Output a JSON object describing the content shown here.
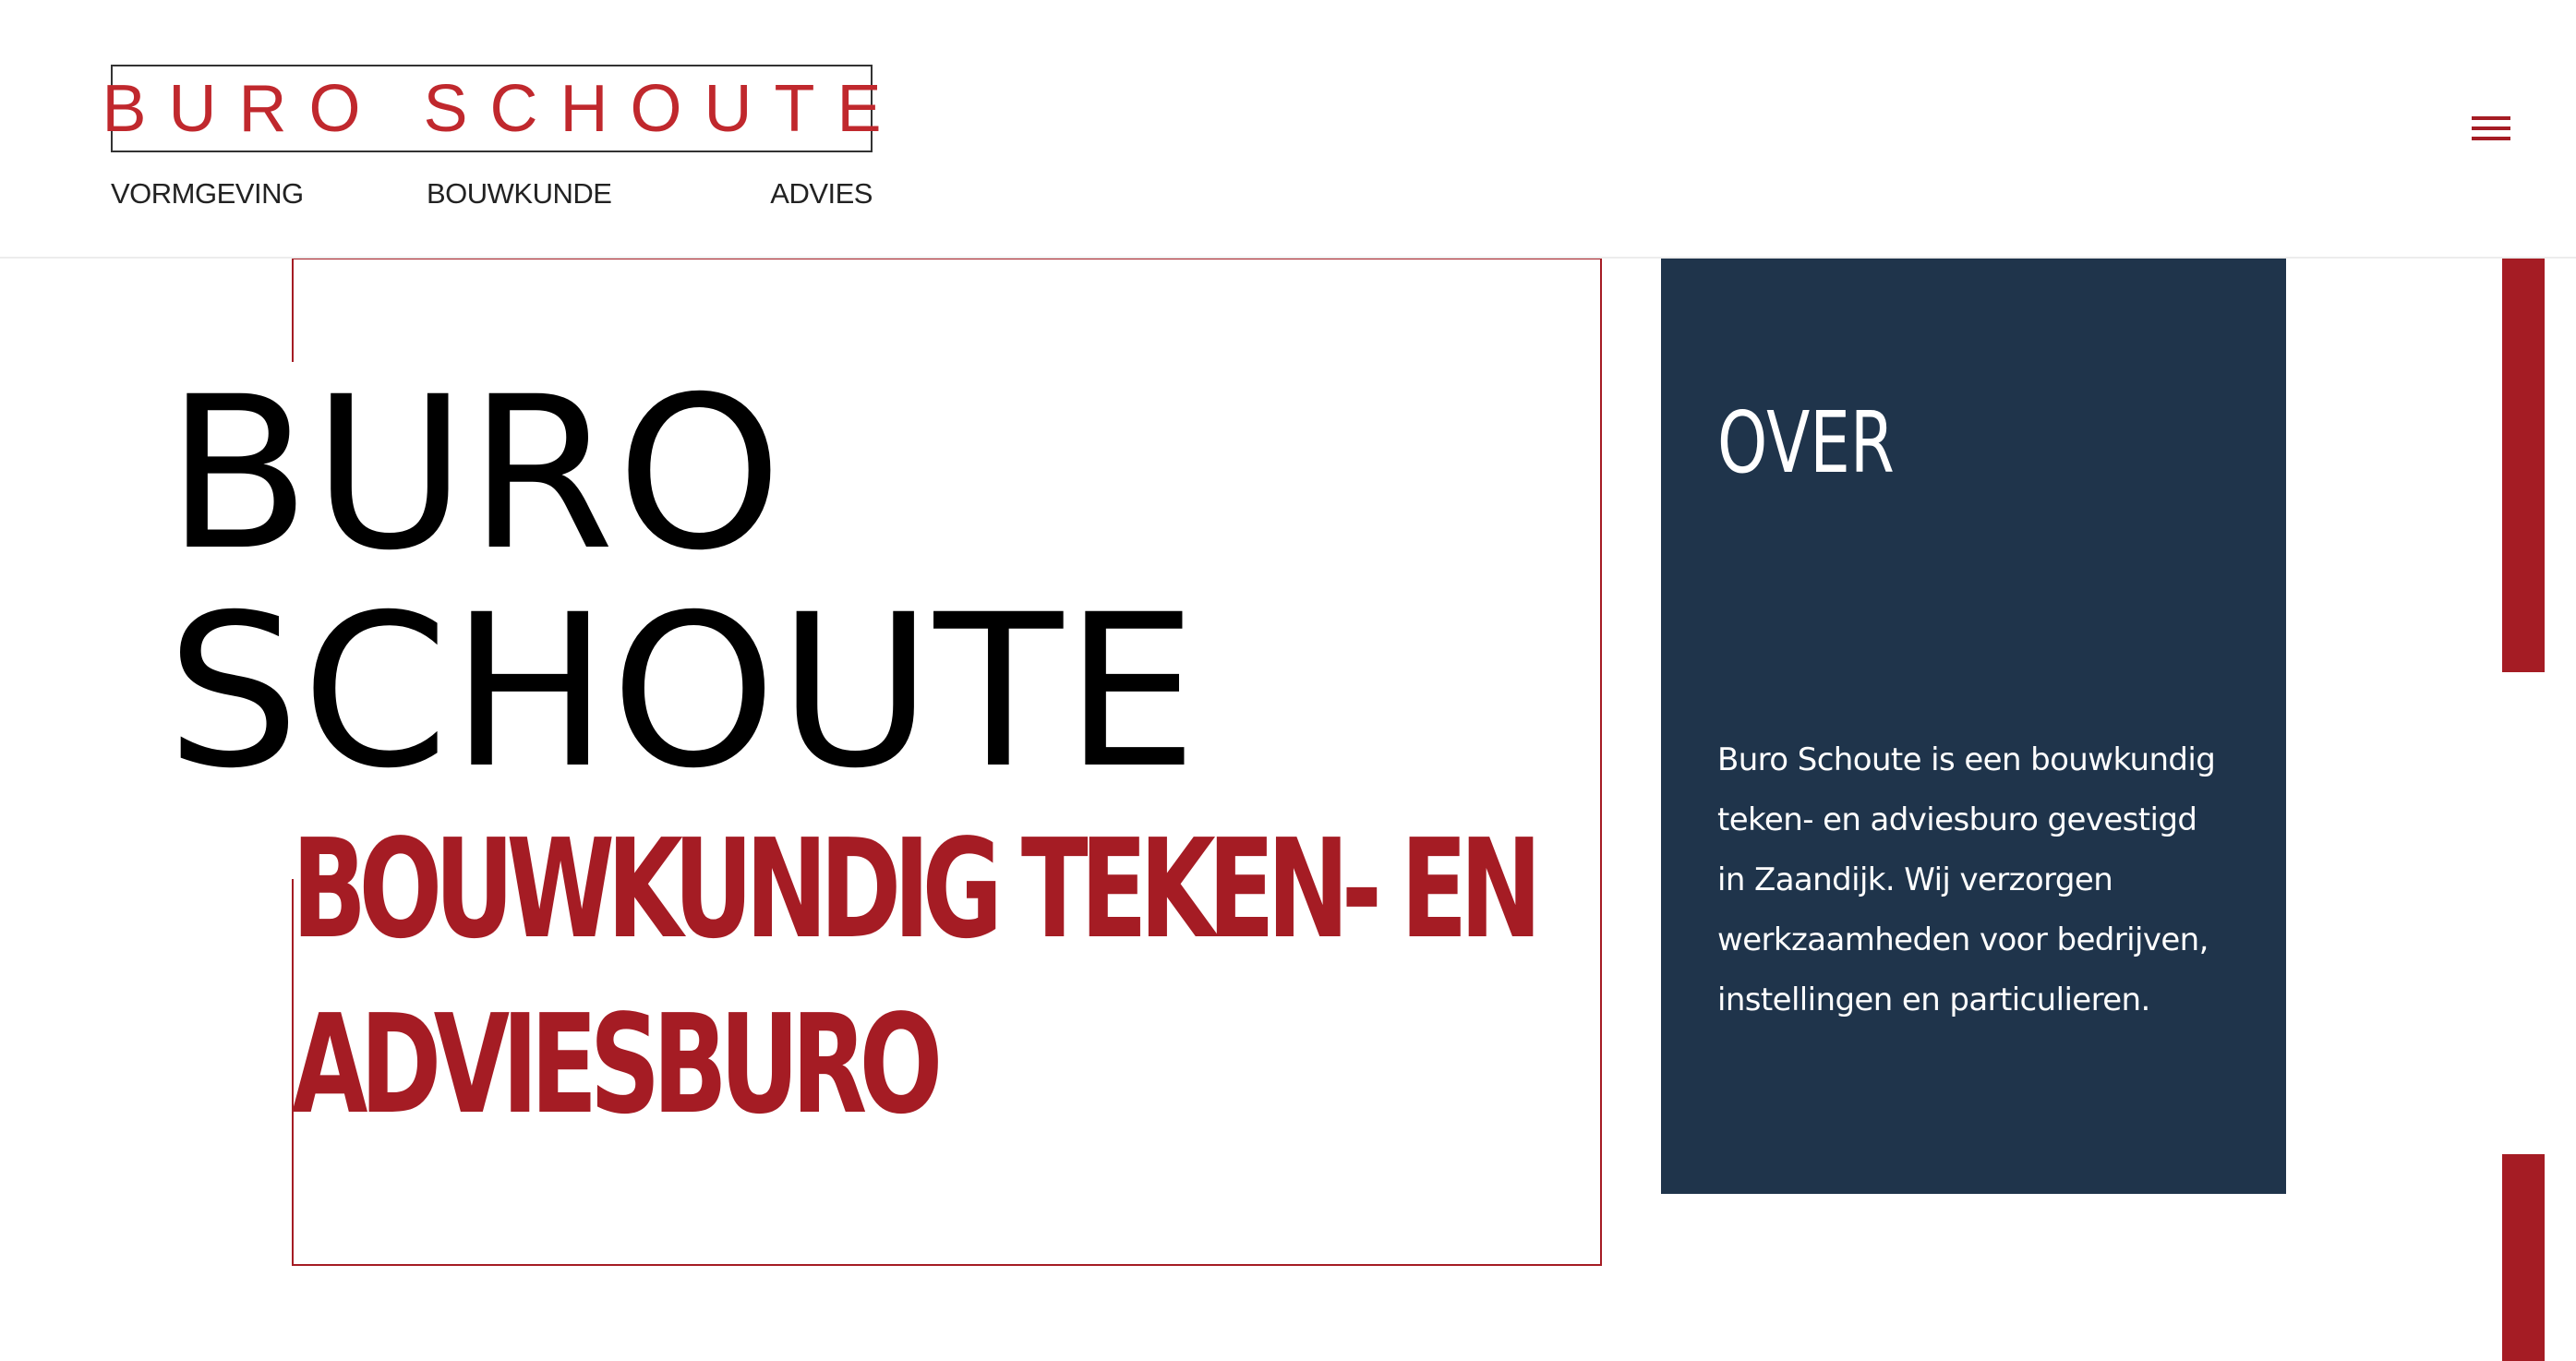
{
  "header": {
    "logo_text": "BURO SCHOUTE",
    "nav": [
      {
        "label": "VORMGEVING"
      },
      {
        "label": "BOUWKUNDE"
      },
      {
        "label": "ADVIES"
      }
    ],
    "menu_icon": "hamburger-menu-icon"
  },
  "hero": {
    "title_lines": [
      "BURO",
      "SCHOUTE"
    ],
    "subtitle_lines": [
      "BOUWKUNDIG TEKEN- EN",
      "ADVIESBURO"
    ]
  },
  "over": {
    "heading": "OVER",
    "text_lines": [
      "Buro Schoute is een bouwkundig",
      "teken- en adviesburo gevestigd",
      "in Zaandijk. Wij verzorgen",
      "werkzaamheden voor bedrijven,",
      "instellingen en particulieren."
    ]
  },
  "colors": {
    "brand_red": "#a51c24",
    "logo_red": "#c0282d",
    "panel_navy": "#1f344b",
    "background": "#ffffff"
  }
}
